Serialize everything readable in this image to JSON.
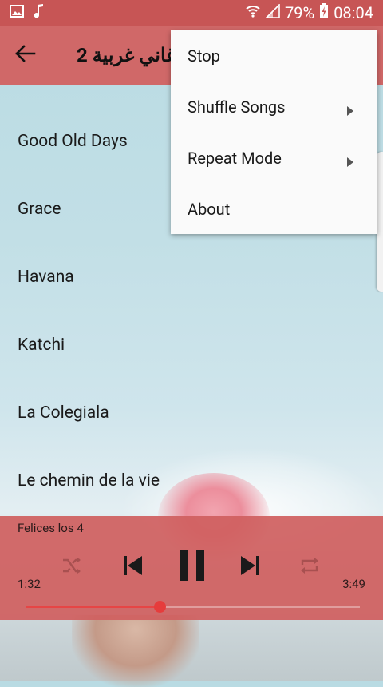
{
  "status_bar": {
    "battery": "79%",
    "time": "08:04",
    "icons": [
      "image-icon",
      "music-note-icon",
      "wifi-icon",
      "signal-icon",
      "battery-charging-icon"
    ]
  },
  "app_bar": {
    "title": "أغاني غربية 2"
  },
  "songs": [
    {
      "label": "Good Old Days"
    },
    {
      "label": "Grace"
    },
    {
      "label": "Havana"
    },
    {
      "label": "Katchi"
    },
    {
      "label": "La Colegiala"
    },
    {
      "label": "Le chemin de la vie"
    }
  ],
  "player": {
    "now_playing": "Felices los 4",
    "elapsed": "1:32",
    "duration": "3:49",
    "progress_fraction": 0.4
  },
  "menu": {
    "items": [
      {
        "label": "Stop",
        "has_submenu": false
      },
      {
        "label": "Shuffle Songs",
        "has_submenu": true
      },
      {
        "label": "Repeat Mode",
        "has_submenu": true
      },
      {
        "label": "About",
        "has_submenu": false
      }
    ]
  },
  "colors": {
    "accent": "#d06868",
    "status_bar": "#c75555",
    "progress": "#e64545"
  }
}
